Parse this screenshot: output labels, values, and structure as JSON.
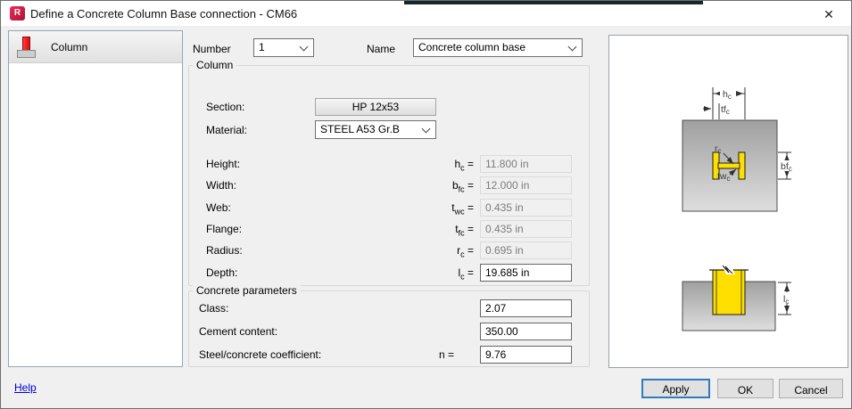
{
  "window": {
    "title": "Define a Concrete Column Base connection - CM66",
    "app_icon_letter": "R",
    "close_glyph": "✕"
  },
  "sidebar": {
    "items": [
      {
        "label": "Column"
      }
    ]
  },
  "header": {
    "number_label": "Number",
    "number_value": "1",
    "name_label": "Name",
    "name_value": "Concrete column base"
  },
  "column_group": {
    "title": "Column",
    "section_label": "Section:",
    "section_value": "HP 12x53",
    "material_label": "Material:",
    "material_value": "STEEL A53 Gr.B",
    "rows": [
      {
        "label": "Height:",
        "sym": "h",
        "sub": "c",
        "eq": "=",
        "value": "11.800 in"
      },
      {
        "label": "Width:",
        "sym": "b",
        "sub": "fc",
        "eq": "=",
        "value": "12.000 in"
      },
      {
        "label": "Web:",
        "sym": "t",
        "sub": "wc",
        "eq": "=",
        "value": "0.435 in"
      },
      {
        "label": "Flange:",
        "sym": "t",
        "sub": "fc",
        "eq": "=",
        "value": "0.435 in"
      },
      {
        "label": "Radius:",
        "sym": "r",
        "sub": "c",
        "eq": "=",
        "value": "0.695 in"
      },
      {
        "label": "Depth:",
        "sym": "l",
        "sub": "c",
        "eq": "=",
        "value": "19.685 in"
      }
    ]
  },
  "concrete_group": {
    "title": "Concrete parameters",
    "rows": [
      {
        "label": "Class:",
        "prefix": "",
        "value": "2.07"
      },
      {
        "label": "Cement content:",
        "prefix": "",
        "value": "350.00"
      },
      {
        "label": "Steel/concrete coefficient:",
        "prefix": "n =",
        "value": "9.76"
      }
    ]
  },
  "diagram": {
    "hc": {
      "base": "h",
      "sub": "c"
    },
    "tfc": {
      "base": "tf",
      "sub": "c"
    },
    "rc": {
      "base": "r",
      "sub": "c"
    },
    "twc": {
      "base": "tw",
      "sub": "c"
    },
    "bfc": {
      "base": "bf",
      "sub": "c"
    },
    "lc": {
      "base": "l",
      "sub": "c"
    }
  },
  "footer": {
    "help": "Help",
    "apply": "Apply",
    "ok": "OK",
    "cancel": "Cancel"
  }
}
